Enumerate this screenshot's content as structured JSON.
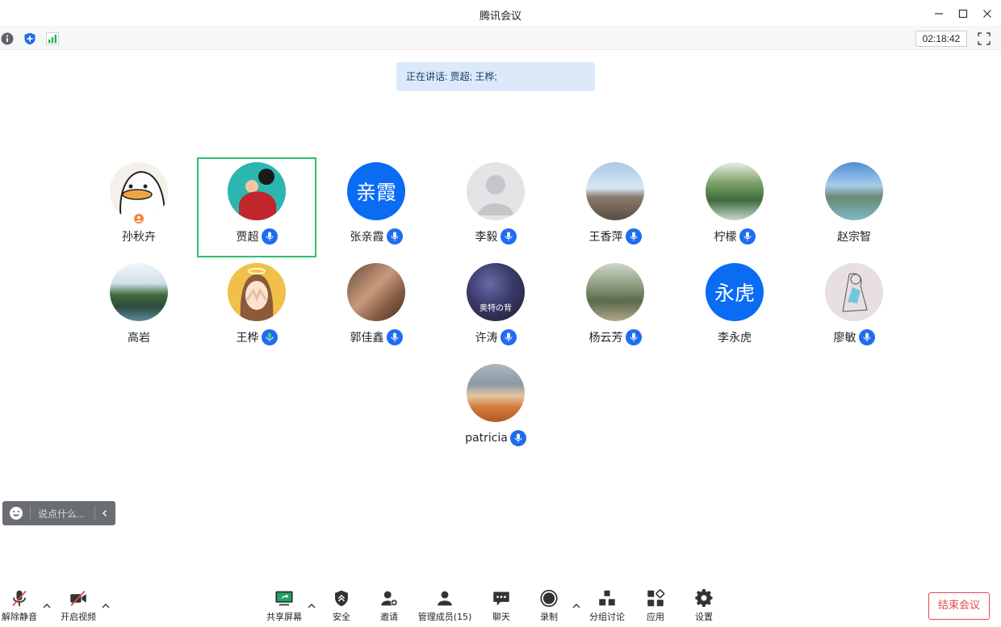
{
  "window": {
    "title": "腾讯会议"
  },
  "status": {
    "timer": "02:18:42"
  },
  "speaking_banner": "正在讲话: 贾超; 王桦;",
  "participants": [
    {
      "name": "孙秋卉",
      "avatar_type": "image",
      "host": true,
      "mic": false
    },
    {
      "name": "贾超",
      "avatar_type": "image",
      "active_speaker": true,
      "mic": true
    },
    {
      "name": "张亲霞",
      "avatar_type": "text",
      "avatar_text": "亲霞",
      "avatar_color": "#0a6cf2",
      "mic": true
    },
    {
      "name": "李毅",
      "avatar_type": "placeholder",
      "mic": true
    },
    {
      "name": "王香萍",
      "avatar_type": "image",
      "mic": true
    },
    {
      "name": "柠檬",
      "avatar_type": "image",
      "mic": true
    },
    {
      "name": "赵宗智",
      "avatar_type": "image",
      "mic": false
    },
    {
      "name": "高岩",
      "avatar_type": "image",
      "mic": false
    },
    {
      "name": "王桦",
      "avatar_type": "image",
      "mic": true
    },
    {
      "name": "郭佳鑫",
      "avatar_type": "image",
      "mic": true
    },
    {
      "name": "许涛",
      "avatar_type": "image",
      "avatar_overlay_text": "奥特の背",
      "mic": true
    },
    {
      "name": "杨云芳",
      "avatar_type": "image",
      "mic": true
    },
    {
      "name": "李永虎",
      "avatar_type": "text",
      "avatar_text": "永虎",
      "avatar_color": "#0a6cf2",
      "mic": false
    },
    {
      "name": "廖敏",
      "avatar_type": "image",
      "mic": true
    },
    {
      "name": "patricia",
      "avatar_type": "image",
      "mic": true
    }
  ],
  "chat": {
    "placeholder": "说点什么..."
  },
  "toolbar": {
    "unmute": "解除静音",
    "start_video": "开启视频",
    "share_screen": "共享屏幕",
    "security": "安全",
    "invite": "邀请",
    "manage_members": "管理成员(15)",
    "chat": "聊天",
    "record": "录制",
    "breakout": "分组讨论",
    "apps": "应用",
    "settings": "设置",
    "end_meeting": "结束会议"
  },
  "colors": {
    "accent": "#1e6cf2",
    "active_border": "#2dbf6f",
    "end_red": "#e5484d",
    "banner_bg": "#dbe9fb"
  }
}
